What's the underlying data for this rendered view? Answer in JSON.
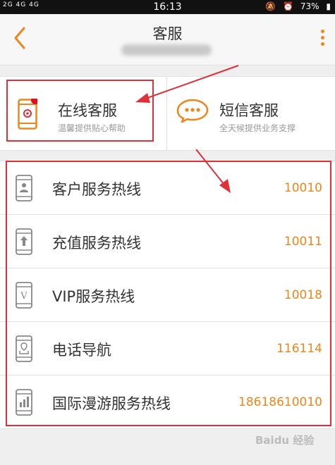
{
  "status_bar": {
    "signal": "2G 4G 4G",
    "time": "16:13",
    "battery": "73%"
  },
  "header": {
    "title": "客服"
  },
  "cards": {
    "online": {
      "title": "在线客服",
      "subtitle": "温馨提供贴心帮助"
    },
    "sms": {
      "title": "短信客服",
      "subtitle": "全天候提供业务支撑"
    }
  },
  "hotlines": [
    {
      "label": "客户服务热线",
      "number": "10010",
      "icon": "user-phone-icon"
    },
    {
      "label": "充值服务热线",
      "number": "10011",
      "icon": "topup-phone-icon"
    },
    {
      "label": "VIP服务热线",
      "number": "10018",
      "icon": "vip-phone-icon"
    },
    {
      "label": "电话导航",
      "number": "116114",
      "icon": "navigation-phone-icon"
    },
    {
      "label": "国际漫游服务热线",
      "number": "18618610010",
      "icon": "roaming-phone-icon"
    }
  ],
  "watermark": "Baidu 经验",
  "colors": {
    "accent": "#f08519",
    "annotation": "#e0303a"
  }
}
